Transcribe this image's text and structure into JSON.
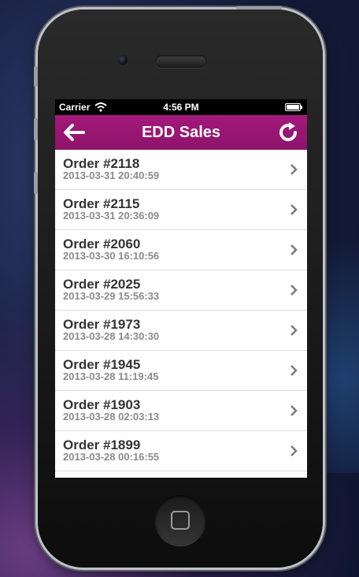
{
  "status_bar": {
    "carrier": "Carrier",
    "time": "4:56 PM"
  },
  "nav": {
    "title": "EDD Sales",
    "back_icon": "back-arrow-icon",
    "refresh_icon": "refresh-icon"
  },
  "colors": {
    "nav_bg": "#9b1775",
    "order_text": "#333333",
    "date_text": "#8a8a8a"
  },
  "orders": [
    {
      "title": "Order #2118",
      "date": "2013-03-31 20:40:59"
    },
    {
      "title": "Order #2115",
      "date": "2013-03-31 20:36:09"
    },
    {
      "title": "Order #2060",
      "date": "2013-03-30 16:10:56"
    },
    {
      "title": "Order #2025",
      "date": "2013-03-29 15:56:33"
    },
    {
      "title": "Order #1973",
      "date": "2013-03-28 14:30:30"
    },
    {
      "title": "Order #1945",
      "date": "2013-03-28 11:19:45"
    },
    {
      "title": "Order #1903",
      "date": "2013-03-28 02:03:13"
    },
    {
      "title": "Order #1899",
      "date": "2013-03-28 00:16:55"
    }
  ]
}
